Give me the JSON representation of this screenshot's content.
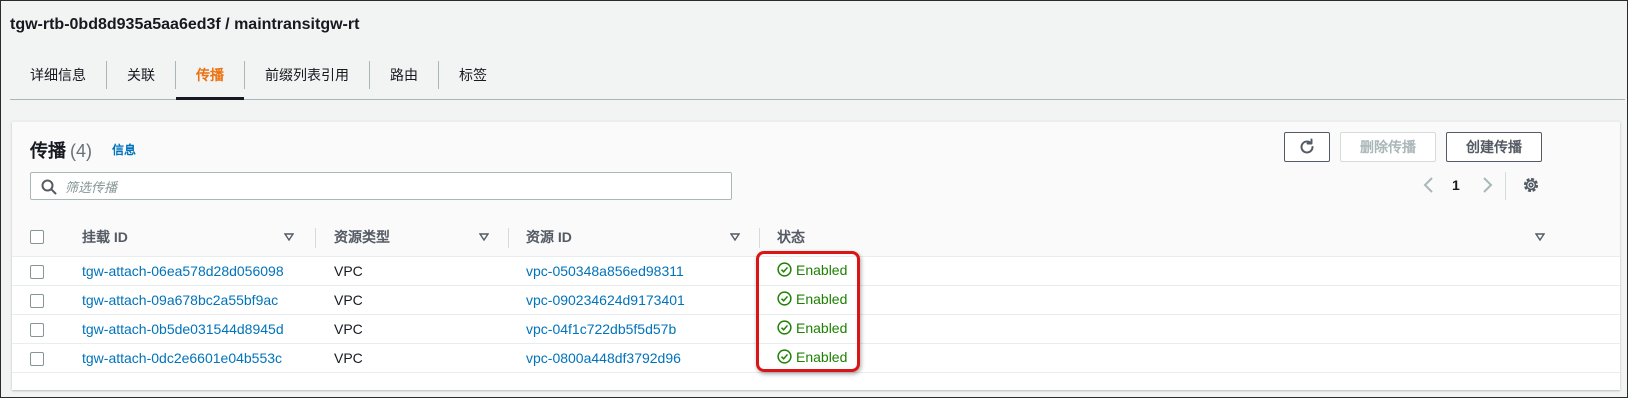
{
  "page": {
    "title": "tgw-rtb-0bd8d935a5aa6ed3f / maintransitgw-rt"
  },
  "tabs": [
    {
      "label": "详细信息",
      "active": false
    },
    {
      "label": "关联",
      "active": false
    },
    {
      "label": "传播",
      "active": true
    },
    {
      "label": "前缀列表引用",
      "active": false
    },
    {
      "label": "路由",
      "active": false
    },
    {
      "label": "标签",
      "active": false
    }
  ],
  "panel": {
    "title": "传播",
    "count": "(4)",
    "info_label": "信息",
    "buttons": {
      "delete": "删除传播",
      "create": "创建传播"
    },
    "search": {
      "placeholder": "筛选传播",
      "value": ""
    },
    "pagination": {
      "current_page": "1"
    }
  },
  "table": {
    "columns": [
      "挂载 ID",
      "资源类型",
      "资源 ID",
      "状态"
    ],
    "rows": [
      {
        "attachment_id": "tgw-attach-06ea578d28d056098",
        "resource_type": "VPC",
        "resource_id": "vpc-050348a856ed98311",
        "status": "Enabled"
      },
      {
        "attachment_id": "tgw-attach-09a678bc2a55bf9ac",
        "resource_type": "VPC",
        "resource_id": "vpc-090234624d9173401",
        "status": "Enabled"
      },
      {
        "attachment_id": "tgw-attach-0b5de031544d8945d",
        "resource_type": "VPC",
        "resource_id": "vpc-04f1c722db5f5d57b",
        "status": "Enabled"
      },
      {
        "attachment_id": "tgw-attach-0dc2e6601e04b553c",
        "resource_type": "VPC",
        "resource_id": "vpc-0800a448df3792d96",
        "status": "Enabled"
      }
    ]
  },
  "colors": {
    "active_tab": "#ec7211",
    "link": "#0073bb",
    "status_enabled": "#1d8102",
    "highlight_box": "#d91515"
  },
  "icons": {
    "refresh": "refresh-icon",
    "search": "search-icon",
    "prev": "chevron-left-icon",
    "next": "chevron-right-icon",
    "settings": "gear-icon",
    "sort": "sort-caret-down-icon",
    "status": "check-circle-icon"
  }
}
